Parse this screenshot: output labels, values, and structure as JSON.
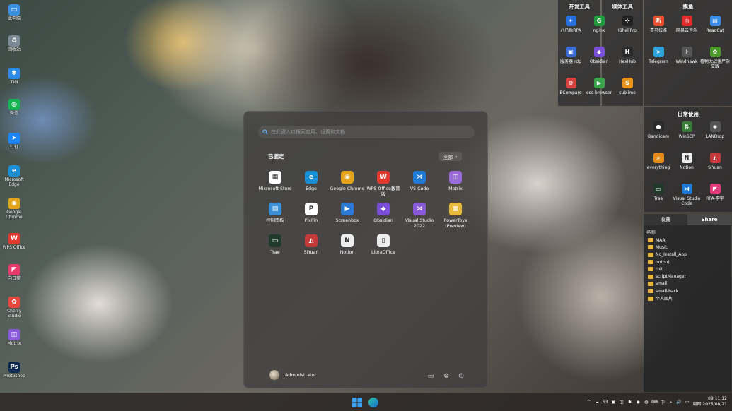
{
  "desktop_icons": [
    {
      "label": "此电脑",
      "icon": "monitor-icon",
      "color": "#3b8fe0",
      "glyph": "▭"
    },
    {
      "label": "回收站",
      "icon": "recycle-bin-icon",
      "color": "#7b8a96",
      "glyph": "♻"
    },
    {
      "label": "TIM",
      "icon": "tim-icon",
      "color": "#2a8ce6",
      "glyph": "✱"
    },
    {
      "label": "微信",
      "icon": "wechat-icon",
      "color": "#17b551",
      "glyph": "◍"
    },
    {
      "label": "钉钉",
      "icon": "dingtalk-icon",
      "color": "#1f86f5",
      "glyph": "➤"
    },
    {
      "label": "Microsoft Edge",
      "icon": "edge-icon",
      "color": "#1a8fd6",
      "glyph": "e"
    },
    {
      "label": "Google Chrome",
      "icon": "chrome-icon",
      "color": "#e3a41a",
      "glyph": "◉"
    },
    {
      "label": "WPS Office",
      "icon": "wps-icon",
      "color": "#e03a2e",
      "glyph": "W"
    },
    {
      "label": "向日葵",
      "icon": "sunflower-icon",
      "color": "#e63b6b",
      "glyph": "◤"
    },
    {
      "label": "Cherry Studio",
      "icon": "cherry-studio-icon",
      "color": "#e8453c",
      "glyph": "✿"
    },
    {
      "label": "Motrix",
      "icon": "motrix-icon",
      "color": "#8a5bd9",
      "glyph": "◫"
    },
    {
      "label": "Photoshop",
      "icon": "photoshop-icon",
      "color": "#0e2a4f",
      "glyph": "Ps"
    }
  ],
  "dev_panel": {
    "title": "开发工具",
    "apps": [
      {
        "label": "八爪鱼RPA",
        "icon": "bazhuayu-rpa-icon",
        "color": "#2a6fe0",
        "glyph": "✦"
      },
      {
        "label": "nginx",
        "icon": "nginx-icon",
        "color": "#1f9a3c",
        "glyph": "G"
      },
      {
        "label": "服务器 rdp",
        "icon": "rdp-icon",
        "color": "#3a6ed6",
        "glyph": "▣"
      },
      {
        "label": "Obsidian",
        "icon": "obsidian-icon",
        "color": "#7a4ed6",
        "glyph": "◆"
      },
      {
        "label": "BCompare",
        "icon": "bcompare-icon",
        "color": "#d94040",
        "glyph": "⚙"
      },
      {
        "label": "oss-browser",
        "icon": "oss-browser-icon",
        "color": "#3aa34a",
        "glyph": "▶"
      }
    ]
  },
  "media_panel": {
    "title": "媒体工具",
    "apps": [
      {
        "label": "IShellPro",
        "icon": "ishellpro-icon",
        "color": "#222222",
        "glyph": "⊹"
      },
      {
        "label": "HexHub",
        "icon": "hexhub-icon",
        "color": "#2a2a2a",
        "glyph": "H"
      },
      {
        "label": "sublime",
        "icon": "sublime-icon",
        "color": "#e8921a",
        "glyph": "S"
      }
    ]
  },
  "fish_panel": {
    "title": "摸鱼",
    "apps": [
      {
        "label": "喜马拉雅",
        "icon": "ximalaya-icon",
        "color": "#e8502e",
        "glyph": "听"
      },
      {
        "label": "网易云音乐",
        "icon": "netease-music-icon",
        "color": "#e02c2c",
        "glyph": "◎"
      },
      {
        "label": "ReadCat",
        "icon": "readcat-icon",
        "color": "#3a8ee6",
        "glyph": "▤"
      },
      {
        "label": "Telegram",
        "icon": "telegram-icon",
        "color": "#2ba3dc",
        "glyph": "➤"
      },
      {
        "label": "Windhawk",
        "icon": "windhawk-icon",
        "color": "#555555",
        "glyph": "✈"
      },
      {
        "label": "植物大战僵尸杂交版",
        "icon": "pvz-icon",
        "color": "#4a9a2a",
        "glyph": "✿"
      }
    ]
  },
  "daily_panel": {
    "title": "日常使用",
    "apps": [
      {
        "label": "Bandicam",
        "icon": "bandicam-icon",
        "color": "#2a2a2a",
        "glyph": "●"
      },
      {
        "label": "WinSCP",
        "icon": "winscp-icon",
        "color": "#3a7a3a",
        "glyph": "⇅"
      },
      {
        "label": "LANDrop",
        "icon": "landrop-icon",
        "color": "#555555",
        "glyph": "◈"
      },
      {
        "label": "everything",
        "icon": "everything-icon",
        "color": "#e88a1a",
        "glyph": "⌕"
      },
      {
        "label": "Notion",
        "icon": "notion-icon",
        "color": "#eeeeee",
        "glyph": "N"
      },
      {
        "label": "SiYuan",
        "icon": "siyuan-icon",
        "color": "#c43a3a",
        "glyph": "◭"
      },
      {
        "label": "Trae",
        "icon": "trae-icon",
        "color": "#1f3a2a",
        "glyph": "▭"
      },
      {
        "label": "Visual Studio Code",
        "icon": "vscode-icon",
        "color": "#1f7ad6",
        "glyph": "⋊"
      },
      {
        "label": "RPA-李宇",
        "icon": "rpa-liyu-icon",
        "color": "#e03a7a",
        "glyph": "◤"
      }
    ]
  },
  "start_menu": {
    "search_placeholder": "在此键入以搜索应用、设置和文档",
    "pinned_label": "已固定",
    "all_label": "全部",
    "pinned_apps": [
      {
        "label": "Microsoft Store",
        "icon": "microsoft-store-icon",
        "color": "#ffffff",
        "glyph": "▦"
      },
      {
        "label": "Edge",
        "icon": "edge-icon",
        "color": "#1a8fd6",
        "glyph": "e"
      },
      {
        "label": "Google Chrome",
        "icon": "chrome-icon",
        "color": "#e3a41a",
        "glyph": "◉"
      },
      {
        "label": "WPS Office教育版",
        "icon": "wps-icon",
        "color": "#e03a2e",
        "glyph": "W"
      },
      {
        "label": "VS Code",
        "icon": "vscode-icon",
        "color": "#1f7ad6",
        "glyph": "⋊"
      },
      {
        "label": "Motrix",
        "icon": "motrix-icon",
        "color": "#9a6bd9",
        "glyph": "◫"
      },
      {
        "label": "控制面板",
        "icon": "control-panel-icon",
        "color": "#3a8ed6",
        "glyph": "▤"
      },
      {
        "label": "PixPin",
        "icon": "pixpin-icon",
        "color": "#ffffff",
        "glyph": "P"
      },
      {
        "label": "Screenbox",
        "icon": "screenbox-icon",
        "color": "#2a7ad6",
        "glyph": "▶"
      },
      {
        "label": "Obsidian",
        "icon": "obsidian-icon",
        "color": "#7a4ed6",
        "glyph": "◆"
      },
      {
        "label": "Visual Studio 2022",
        "icon": "visual-studio-icon",
        "color": "#8a5bd9",
        "glyph": "⋊"
      },
      {
        "label": "PowerToys (Preview)",
        "icon": "powertoys-icon",
        "color": "#e8b93a",
        "glyph": "▦"
      },
      {
        "label": "Trae",
        "icon": "trae-icon",
        "color": "#1f3a2a",
        "glyph": "▭"
      },
      {
        "label": "SiYuan",
        "icon": "siyuan-icon",
        "color": "#c43a3a",
        "glyph": "◭"
      },
      {
        "label": "Notion",
        "icon": "notion-icon",
        "color": "#eeeeee",
        "glyph": "N"
      },
      {
        "label": "LibreOffice",
        "icon": "libreoffice-icon",
        "color": "#eeeeee",
        "glyph": "▯"
      }
    ],
    "user_name": "Administrator"
  },
  "files_panel": {
    "tabs": [
      "收藏",
      "Share"
    ],
    "header": "名称",
    "folders": [
      "MAA",
      "Music",
      "No_Install_App",
      "output",
      "rhlt",
      "scriptManager",
      "small",
      "small-back",
      "个人图片"
    ]
  },
  "taskbar": {
    "tray": [
      "^",
      "☁",
      "S3",
      "▣",
      "◫",
      "✱",
      "◉",
      "◍",
      "⌨",
      "中",
      "⌁",
      "🔊",
      "▭"
    ],
    "time": "09:11:12",
    "date": "周四 2025/08/21"
  }
}
